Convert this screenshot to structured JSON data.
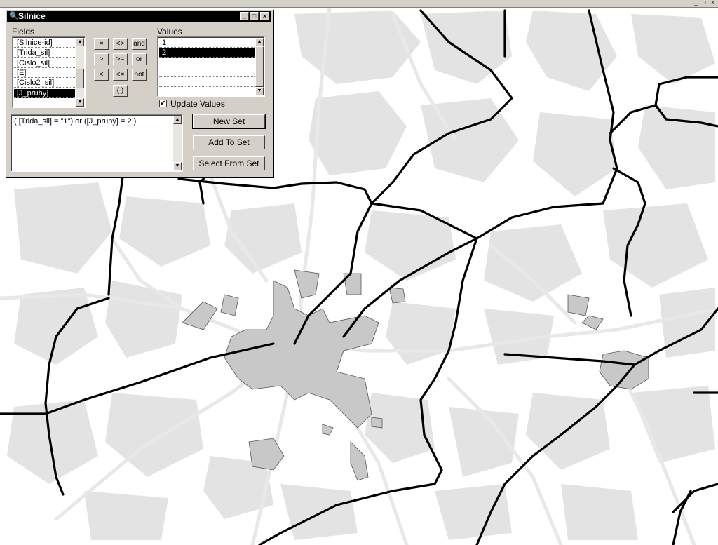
{
  "window_title": "Silnice",
  "title_icon": "query-icon",
  "titlebar_buttons": [
    "minimize-icon",
    "maximize-icon",
    "close-icon"
  ],
  "fields_label": "Fields",
  "fields": [
    "[Silnice-id]",
    "[Trida_sil]",
    "[Cislo_sil]",
    "[E]",
    "[Cislo2_sil]",
    "[J_pruhy]"
  ],
  "fields_selected_index": 5,
  "operators": [
    "=",
    "<>",
    "and",
    ">",
    ">=",
    "or",
    "<",
    "<=",
    "not",
    "( )"
  ],
  "values_label": "Values",
  "values": [
    "1",
    "2"
  ],
  "values_selected_index": 1,
  "update_values_label": "Update Values",
  "update_values_checked": true,
  "expression": "( [Trida_sil] = \"1\") or ([J_pruhy] = 2 )",
  "buttons": {
    "new_set": "New Set",
    "add_to_set": "Add To Set",
    "select_from_set": "Select From Set"
  },
  "map": {
    "background": "#ffffff",
    "area_fill": "#e3e3e3",
    "settlement_fill": "#c8c8c8",
    "minor_road": "#e8e8e8",
    "selected_road": "#000000"
  }
}
